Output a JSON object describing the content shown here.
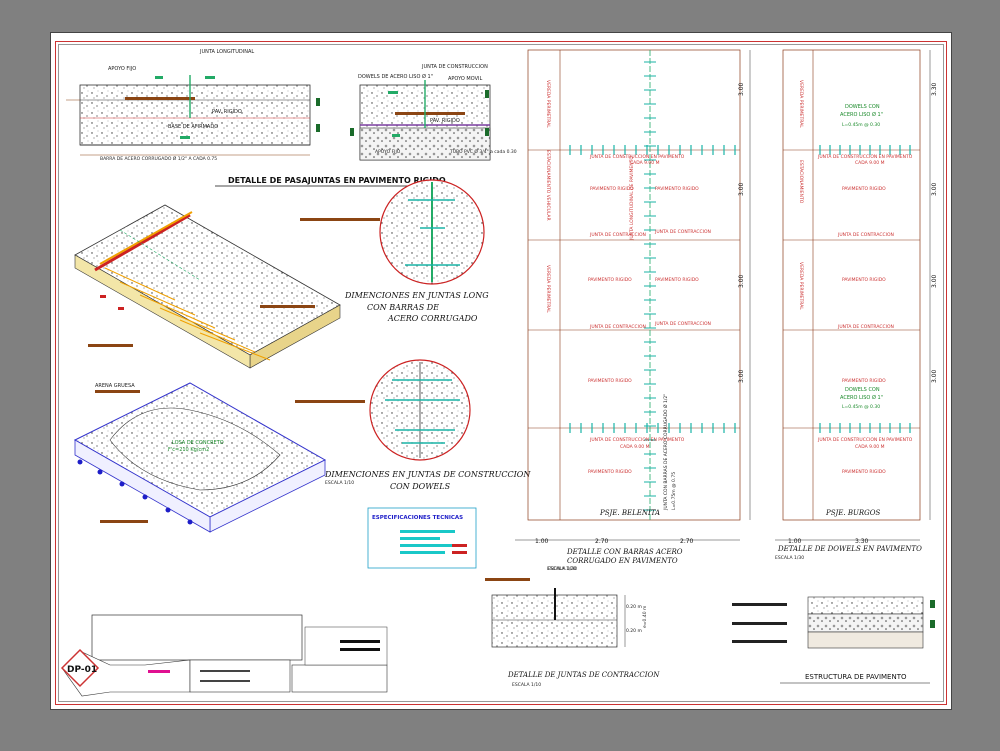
{
  "colors": {
    "background": "#808080",
    "sheet": "#ffffff",
    "label_dark": "#1a1a1a",
    "label_red": "#cc3333",
    "label_green": "#22aa66",
    "label_teal": "#19b3a6",
    "label_brown": "#8b4513",
    "label_blue": "#1e1ec8",
    "title_ink": "#2b1a66"
  },
  "top_left_section": {
    "callout_joint": "JUNTA LONGITUDINAL",
    "callout_apoyo": "APOYO FIJO",
    "callout_pav": "PAV. RIGIDO",
    "callout_base": "BASE DE AFIRMADO",
    "callout_barras": "BARRA DE ACERO CORRUGADO Ø 1/2\" A CADA 0.75"
  },
  "top_mid_section": {
    "callout_dowels": "DOWELS DE ACERO LISO Ø 1\"",
    "callout_junta": "JUNTA DE CONSTRUCCION",
    "callout_apoyo": "APOYO MOVIL",
    "callout_pav": "PAV. RIGIDO",
    "callout_apoyo_fijo": "APOYO FIJO",
    "callout_tubo": "TUBO PVC Ø 3/4\" a cada 0.30"
  },
  "detail_titles": {
    "pasajuntas": "DETALLE DE PASAJUNTAS EN PAVIMENTO RIGIDO",
    "dim_long_1": "DIMENCIONES EN JUNTAS LONG",
    "dim_long_2": "CON BARRAS DE",
    "dim_long_3": "ACERO CORRUGADO",
    "dim_const_1": "DIMENCIONES EN JUNTAS DE CONSTRUCCION",
    "dim_const_2": "CON DOWELS",
    "escala_1_10": "ESCALA 1/10",
    "arena_gruesa": "ARENA GRUESA",
    "losa_label_1": "LOSA DE CONCRETO",
    "losa_label_2": "F'c=210 Kg/cm2"
  },
  "specs_box": {
    "title": "ESPECIFICACIONES TECNICAS"
  },
  "plan_left": {
    "side_labels": [
      "VEREDA PERIMETRAL",
      "ESTACIONAMIENTO VEHICULAR",
      "VEREDA PERIMETRAL"
    ],
    "junta_construccion": "JUNTA DE CONSTRUCCION EN PAVIMENTO",
    "cada": "CADA 9.00 M",
    "pavimento": "PAVIMENTO RIGIDO",
    "junta_contraccion": "JUNTA DE CONTRACCION",
    "longitudinal": "JUNTA LONGITUDINAL DE PAVIMENTO",
    "barras_1": "JUNTA CON BARRAS DE ACERO CORRUGADO Ø 1/2\"",
    "barras_2": "L=0.75m @ 0.75",
    "street": "PSJE. BELENITA",
    "dims_h": [
      "1.00",
      "2.70",
      "2.70"
    ],
    "dims_v": [
      "3.00",
      "3.00",
      "3.00",
      "3.00"
    ],
    "title_1": "DETALLE CON BARRAS ACERO",
    "title_2": "CORRUGADO EN PAVIMENTO",
    "escala": "ESCALA 1/30"
  },
  "plan_right": {
    "side_labels": [
      "VEREDA PERIMETRAL",
      "ESTACIONAMIENTO",
      "VEREDA PERIMETRAL"
    ],
    "dowels_1": "DOWELS CON",
    "dowels_2": "ACERO LISO Ø 1\"",
    "dowels_3": "L=0.45m @ 0.30",
    "junta_construccion": "JUNTA DE CONSTRUCCION EN PAVIMENTO",
    "cada": "CADA 9.00 M",
    "pavimento": "PAVIMENTO RIGIDO",
    "junta_contraccion": "JUNTA DE CONTRACCION",
    "street": "PSJE. BURGOS",
    "dims_h": [
      "1.00",
      "3.30"
    ],
    "dims_v": [
      "3.30",
      "3.00",
      "3.00",
      "3.00"
    ],
    "title": "DETALLE DE DOWELS EN PAVIMENTO",
    "escala": "ESCALA 1/30"
  },
  "bottom_details": {
    "contraccion_title": "DETALLE DE JUNTAS DE CONTRACCION",
    "contraccion_escala": "ESCALA 1/10",
    "contraccion_escala_top": "ESCALA 1/20",
    "dim_020": "0.20 m",
    "dim_040": "0.20 m",
    "dim_total": "e=0.40 m",
    "estructura_title": "ESTRUCTURA DE PAVIMENTO"
  },
  "title_block": {
    "sheet_code": "DP-01"
  }
}
